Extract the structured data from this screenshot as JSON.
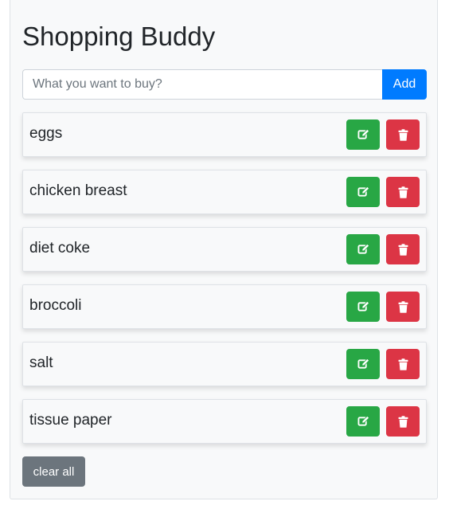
{
  "app": {
    "title": "Shopping Buddy"
  },
  "search": {
    "placeholder": "What you want to buy?",
    "value": "",
    "add_label": "Add"
  },
  "items": [
    {
      "label": "eggs"
    },
    {
      "label": "chicken breast"
    },
    {
      "label": "diet coke"
    },
    {
      "label": "broccoli"
    },
    {
      "label": "salt"
    },
    {
      "label": "tissue paper"
    }
  ],
  "actions": {
    "edit_icon": "edit-icon",
    "delete_icon": "trash-icon",
    "clear_label": "clear all"
  },
  "colors": {
    "primary": "#007bff",
    "success": "#28a745",
    "danger": "#dc3545",
    "secondary": "#6c757d"
  }
}
